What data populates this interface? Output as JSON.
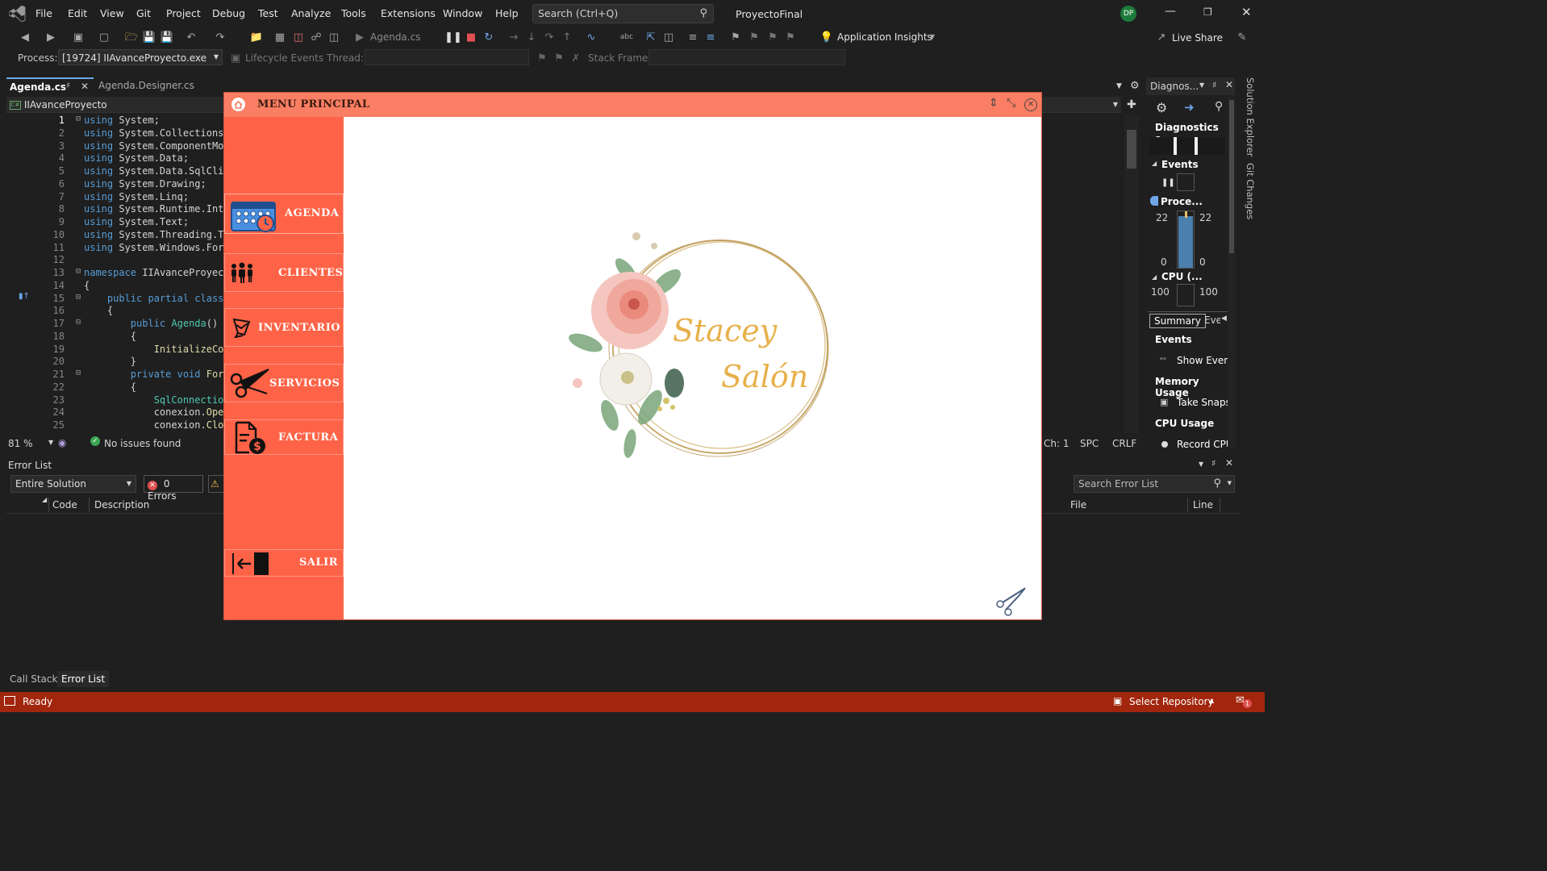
{
  "titlebar": {
    "menu": [
      "File",
      "Edit",
      "View",
      "Git",
      "Project",
      "Debug",
      "Test",
      "Analyze",
      "Tools",
      "Extensions",
      "Window",
      "Help"
    ],
    "search_placeholder": "Search (Ctrl+Q)",
    "solution_name": "ProyectoFinal",
    "user_initials": "DP"
  },
  "toolbar": {
    "run_target": "Agenda.cs",
    "application_insights": "Application Insights",
    "live_share": "Live Share"
  },
  "debugbar": {
    "process_label": "Process:",
    "process_value": "[19724] IIAvanceProyecto.exe",
    "lifecycle_events": "Lifecycle Events",
    "thread_label": "Thread:",
    "stack_frame_label": "Stack Frame:"
  },
  "editor": {
    "tabs": [
      {
        "label": "Agenda.cs",
        "active": true
      },
      {
        "label": "Agenda.Designer.cs",
        "active": false
      }
    ],
    "project_dropdown": "IIAvanceProyecto",
    "lines": [
      {
        "n": "1",
        "tokens": [
          [
            "kw",
            "using"
          ],
          [
            "",
            "System;"
          ]
        ]
      },
      {
        "n": "2",
        "tokens": [
          [
            "kw",
            "using"
          ],
          [
            "",
            "System.Collections"
          ]
        ]
      },
      {
        "n": "3",
        "tokens": [
          [
            "kw",
            "using"
          ],
          [
            "",
            "System.ComponentMo"
          ]
        ]
      },
      {
        "n": "4",
        "tokens": [
          [
            "kw",
            "using"
          ],
          [
            "",
            "System.Data;"
          ]
        ]
      },
      {
        "n": "5",
        "tokens": [
          [
            "kw",
            "using"
          ],
          [
            "",
            "System.Data.SqlCli"
          ]
        ]
      },
      {
        "n": "6",
        "tokens": [
          [
            "kw",
            "using"
          ],
          [
            "",
            "System.Drawing;"
          ]
        ]
      },
      {
        "n": "7",
        "tokens": [
          [
            "kw",
            "using"
          ],
          [
            "",
            "System.Linq;"
          ]
        ]
      },
      {
        "n": "8",
        "tokens": [
          [
            "kw",
            "using"
          ],
          [
            "",
            "System.Runtime.Int"
          ]
        ]
      },
      {
        "n": "9",
        "tokens": [
          [
            "kw",
            "using"
          ],
          [
            "",
            "System.Text;"
          ]
        ]
      },
      {
        "n": "10",
        "tokens": [
          [
            "kw",
            "using"
          ],
          [
            "",
            "System.Threading.T"
          ]
        ]
      },
      {
        "n": "11",
        "tokens": [
          [
            "kw",
            "using"
          ],
          [
            "",
            "System.Windows.For"
          ]
        ]
      },
      {
        "n": "12",
        "tokens": []
      },
      {
        "n": "13",
        "tokens": [
          [
            "kw",
            "namespace"
          ],
          [
            "",
            "IIAvanceProyec"
          ]
        ]
      },
      {
        "n": "14",
        "tokens": [
          [
            "",
            "{"
          ]
        ]
      },
      {
        "n": "15",
        "tokens": [
          [
            "",
            "    "
          ],
          [
            "kw",
            "public partial class"
          ]
        ]
      },
      {
        "n": "16",
        "tokens": [
          [
            "",
            "    {"
          ]
        ]
      },
      {
        "n": "17",
        "tokens": [
          [
            "",
            "        "
          ],
          [
            "kw",
            "public"
          ],
          [
            "",
            ""
          ],
          [
            "tp",
            "Agenda"
          ],
          [
            "",
            "()"
          ]
        ]
      },
      {
        "n": "18",
        "tokens": [
          [
            "",
            "        {"
          ]
        ]
      },
      {
        "n": "19",
        "tokens": [
          [
            "",
            "            "
          ],
          [
            "fn",
            "InitializeCo"
          ]
        ]
      },
      {
        "n": "20",
        "tokens": [
          [
            "",
            "        }"
          ]
        ]
      },
      {
        "n": "21",
        "tokens": [
          [
            "",
            "        "
          ],
          [
            "kw",
            "private void"
          ],
          [
            "",
            ""
          ],
          [
            "fn",
            "For"
          ]
        ]
      },
      {
        "n": "22",
        "tokens": [
          [
            "",
            "        {"
          ]
        ]
      },
      {
        "n": "23",
        "tokens": [
          [
            "",
            "            "
          ],
          [
            "tp",
            "SqlConnectio"
          ]
        ]
      },
      {
        "n": "24",
        "tokens": [
          [
            "",
            "            conexion."
          ],
          [
            "fn",
            "Ope"
          ]
        ]
      },
      {
        "n": "25",
        "tokens": [
          [
            "",
            "            conexion."
          ],
          [
            "fn",
            "Clo"
          ]
        ]
      }
    ],
    "zoom": "81 %",
    "issues": "No issues found",
    "ch": "Ch: 1",
    "spc": "SPC",
    "crlf": "CRLF"
  },
  "app": {
    "title": "MENU PRINCIPAL",
    "buttons": [
      "AGENDA",
      "CLIENTES",
      "INVENTARIO",
      "SERVICIOS",
      "FACTURA",
      "SALIR"
    ],
    "logo_line1": "Stacey",
    "logo_line2": "Salón"
  },
  "diagnostics": {
    "title": "Diagnos...",
    "session": "Diagnostics s...",
    "events": "Events",
    "process": "Proce...",
    "mem_max_left": "22",
    "mem_max_right": "22",
    "mem_min_left": "0",
    "mem_min_right": "0",
    "cpu": "CPU (...",
    "cpu_left": "100",
    "cpu_right": "100",
    "tabs": [
      "Summary",
      "Eve"
    ],
    "sections": [
      {
        "title": "Events",
        "action": "Show Even"
      },
      {
        "title": "Memory Usage",
        "action": "Take Snaps"
      },
      {
        "title": "CPU Usage",
        "action": "Record CPU"
      }
    ],
    "side_tabs": [
      "Solution Explorer",
      "Git Changes"
    ]
  },
  "error_list": {
    "title": "Error List",
    "scope": "Entire Solution",
    "errors": "0 Errors",
    "search_placeholder": "Search Error List",
    "columns": [
      "Code",
      "Description",
      "File",
      "Line"
    ]
  },
  "bottom_tabs": [
    "Call Stack",
    "Error List"
  ],
  "status": {
    "ready": "Ready",
    "select_repo": "Select Repository",
    "notifications": "1"
  },
  "colors": {
    "app_title": "#fa7e63",
    "app_side": "#ff6347",
    "status_bar": "#a1260d",
    "logo_text": "#e8b04a"
  }
}
